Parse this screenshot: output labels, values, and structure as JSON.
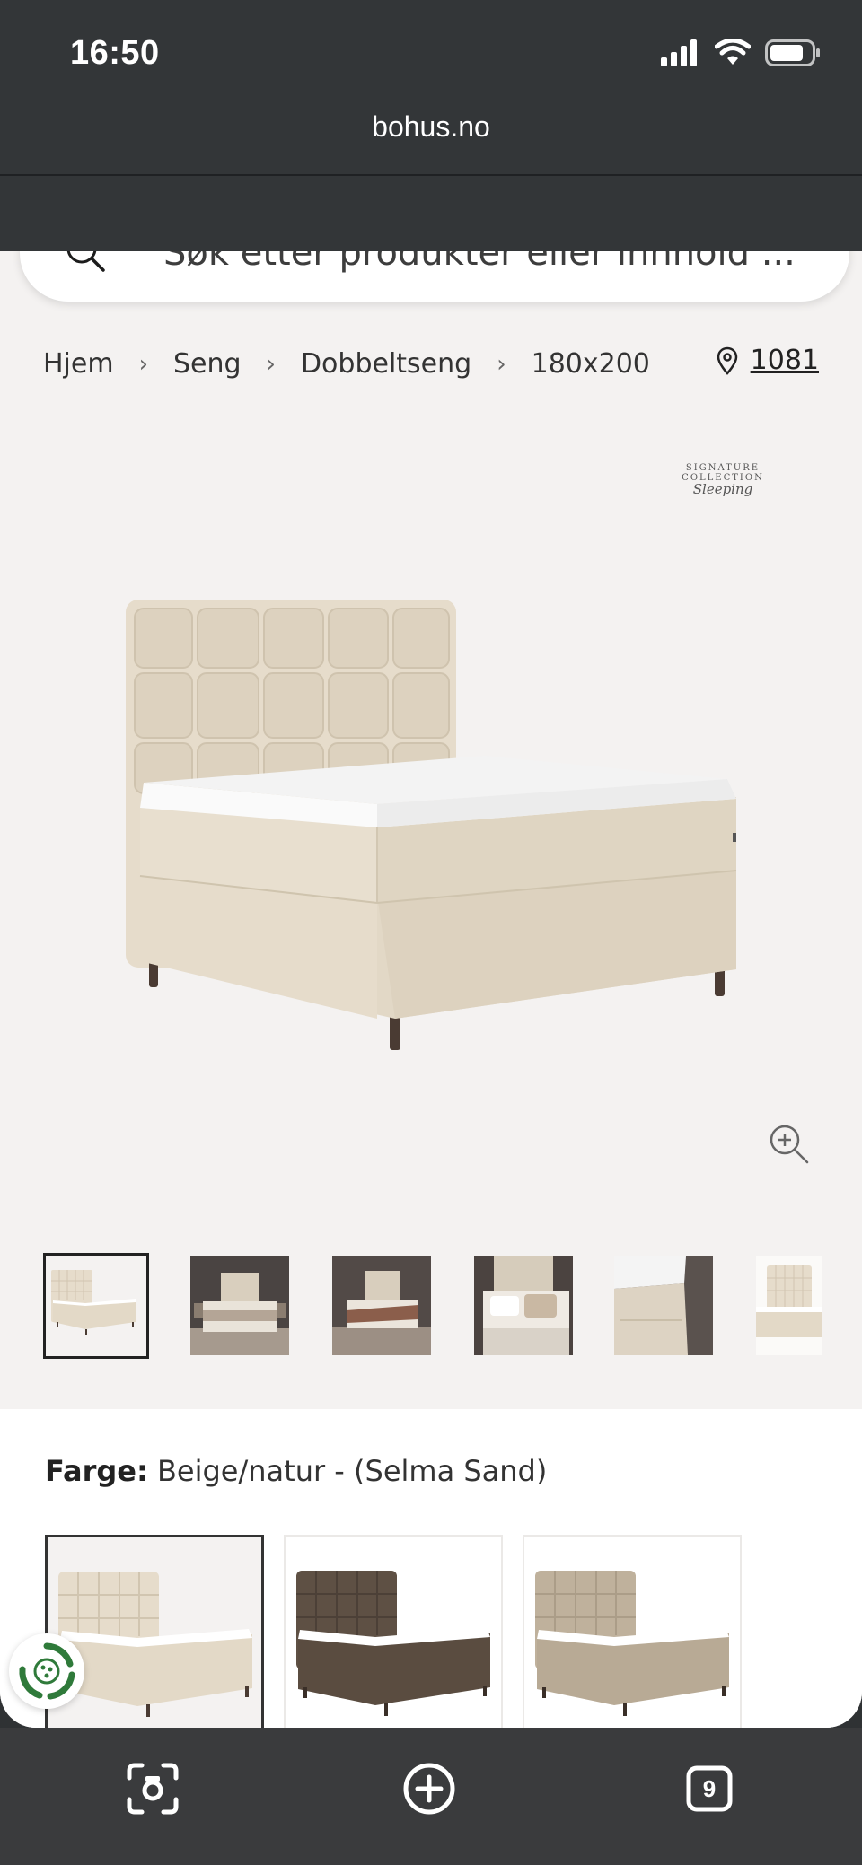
{
  "status": {
    "time": "16:50"
  },
  "browser": {
    "url": "bohus.no",
    "tab_count": "9"
  },
  "search": {
    "placeholder": "Søk etter produkter eller innhold ..."
  },
  "breadcrumb": [
    "Hjem",
    "Seng",
    "Dobbeltseng",
    "180x200"
  ],
  "store": {
    "number": "1081"
  },
  "brand_logo": {
    "line1": "SIGNATURE COLLECTION",
    "line2": "Sleeping"
  },
  "product": {
    "color_label": "Farge:",
    "color_value": "Beige/natur - (Selma Sand)",
    "swatches": [
      {
        "name": "Beige/natur",
        "color": "#e6dccb",
        "selected": true
      },
      {
        "name": "Brun",
        "color": "#5e5044",
        "selected": false
      },
      {
        "name": "Sand",
        "color": "#bfb19c",
        "selected": false
      }
    ]
  },
  "icons": {
    "search": "search-icon",
    "location": "location-pin-icon",
    "zoom": "zoom-in-icon",
    "camera": "camera-search-icon",
    "new_tab": "plus-circle-icon",
    "tabs": "tabs-icon",
    "eco": "recycle-icon"
  },
  "colors": {
    "accent_dark": "#333638",
    "page_bg": "#f4f2f1",
    "bed_fabric": "#e6dccb"
  }
}
